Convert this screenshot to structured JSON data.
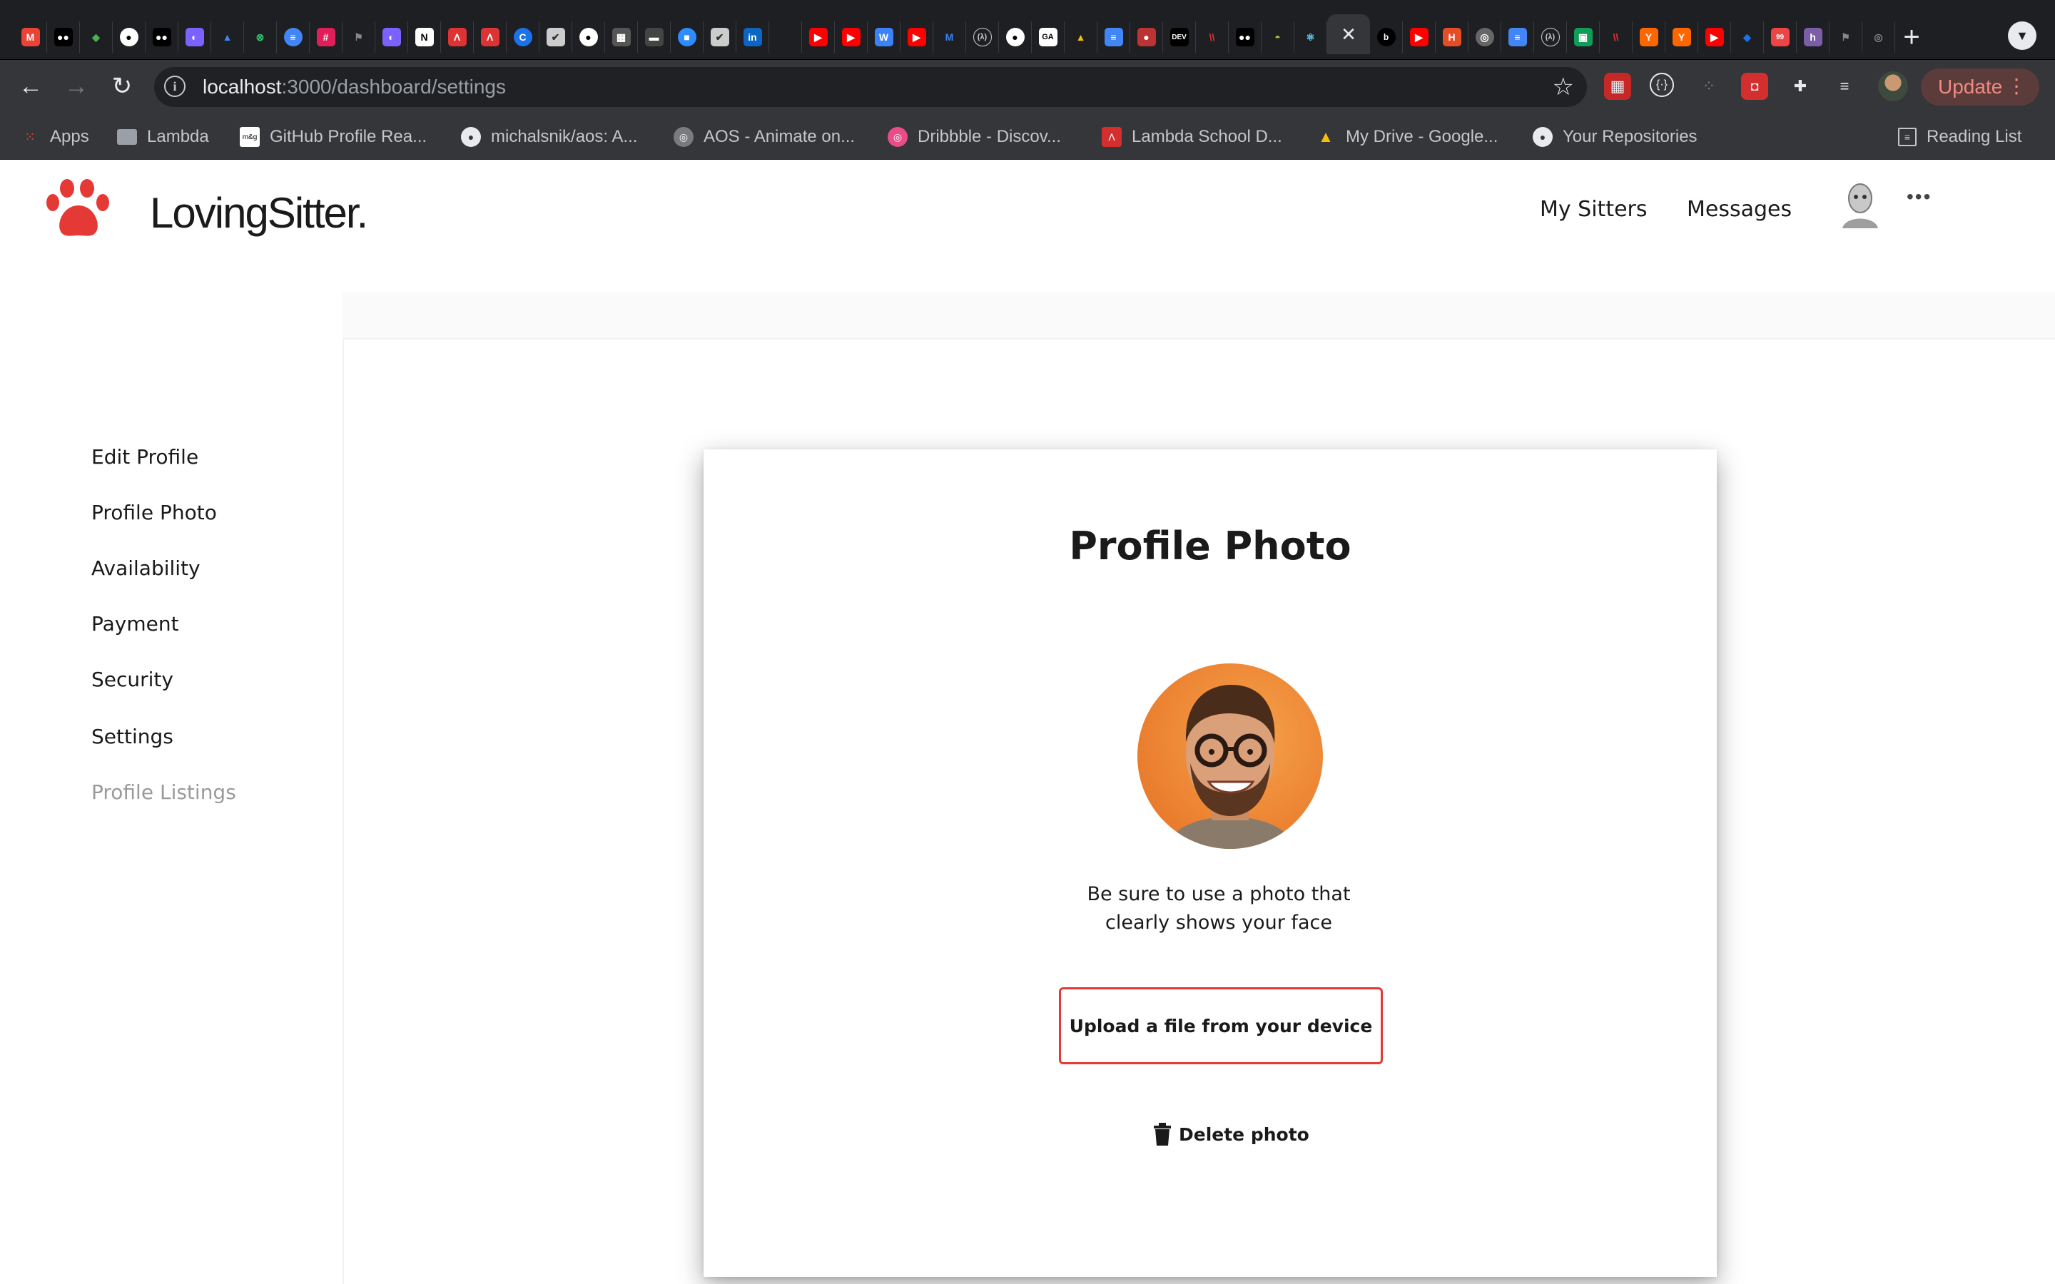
{
  "browser": {
    "url_host": "localhost",
    "url_path": ":3000/dashboard/settings",
    "update_label": "Update",
    "bookmarks": [
      {
        "label": "Apps",
        "icon": "apps-grid-icon"
      },
      {
        "label": "Lambda",
        "icon": "folder-icon"
      },
      {
        "label": "GitHub Profile Rea...",
        "icon": "mxg-icon"
      },
      {
        "label": "michalsnik/aos: A...",
        "icon": "github-icon"
      },
      {
        "label": "AOS - Animate on...",
        "icon": "globe-icon"
      },
      {
        "label": "Dribbble - Discov...",
        "icon": "dribbble-icon"
      },
      {
        "label": "Lambda School D...",
        "icon": "lambda-shield-icon"
      },
      {
        "label": "My Drive - Google...",
        "icon": "google-drive-icon"
      },
      {
        "label": "Your Repositories",
        "icon": "github-icon"
      }
    ],
    "reading_list_label": "Reading List"
  },
  "app": {
    "brand": "LovingSitter.",
    "accent_color": "#e53935",
    "nav": {
      "my_sitters": "My Sitters",
      "messages": "Messages"
    },
    "sidebar": {
      "items": [
        {
          "label": "Edit Profile"
        },
        {
          "label": "Profile Photo"
        },
        {
          "label": "Availability"
        },
        {
          "label": "Payment"
        },
        {
          "label": "Security"
        },
        {
          "label": "Settings"
        },
        {
          "label": "Profile Listings"
        }
      ]
    },
    "card": {
      "title": "Profile Photo",
      "hint_line1": "Be sure to use a photo that",
      "hint_line2": "clearly shows your face",
      "upload_label": "Upload a file from your device",
      "delete_label": "Delete photo"
    }
  }
}
